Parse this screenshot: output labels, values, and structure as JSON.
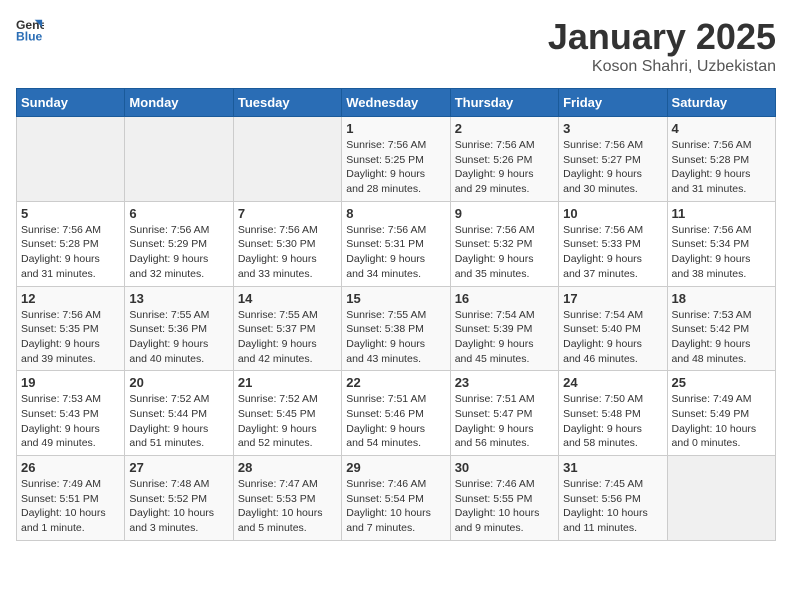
{
  "header": {
    "logo_general": "General",
    "logo_blue": "Blue",
    "title": "January 2025",
    "subtitle": "Koson Shahri, Uzbekistan"
  },
  "weekdays": [
    "Sunday",
    "Monday",
    "Tuesday",
    "Wednesday",
    "Thursday",
    "Friday",
    "Saturday"
  ],
  "weeks": [
    [
      {
        "day": "",
        "info": ""
      },
      {
        "day": "",
        "info": ""
      },
      {
        "day": "",
        "info": ""
      },
      {
        "day": "1",
        "info": "Sunrise: 7:56 AM\nSunset: 5:25 PM\nDaylight: 9 hours\nand 28 minutes."
      },
      {
        "day": "2",
        "info": "Sunrise: 7:56 AM\nSunset: 5:26 PM\nDaylight: 9 hours\nand 29 minutes."
      },
      {
        "day": "3",
        "info": "Sunrise: 7:56 AM\nSunset: 5:27 PM\nDaylight: 9 hours\nand 30 minutes."
      },
      {
        "day": "4",
        "info": "Sunrise: 7:56 AM\nSunset: 5:28 PM\nDaylight: 9 hours\nand 31 minutes."
      }
    ],
    [
      {
        "day": "5",
        "info": "Sunrise: 7:56 AM\nSunset: 5:28 PM\nDaylight: 9 hours\nand 31 minutes."
      },
      {
        "day": "6",
        "info": "Sunrise: 7:56 AM\nSunset: 5:29 PM\nDaylight: 9 hours\nand 32 minutes."
      },
      {
        "day": "7",
        "info": "Sunrise: 7:56 AM\nSunset: 5:30 PM\nDaylight: 9 hours\nand 33 minutes."
      },
      {
        "day": "8",
        "info": "Sunrise: 7:56 AM\nSunset: 5:31 PM\nDaylight: 9 hours\nand 34 minutes."
      },
      {
        "day": "9",
        "info": "Sunrise: 7:56 AM\nSunset: 5:32 PM\nDaylight: 9 hours\nand 35 minutes."
      },
      {
        "day": "10",
        "info": "Sunrise: 7:56 AM\nSunset: 5:33 PM\nDaylight: 9 hours\nand 37 minutes."
      },
      {
        "day": "11",
        "info": "Sunrise: 7:56 AM\nSunset: 5:34 PM\nDaylight: 9 hours\nand 38 minutes."
      }
    ],
    [
      {
        "day": "12",
        "info": "Sunrise: 7:56 AM\nSunset: 5:35 PM\nDaylight: 9 hours\nand 39 minutes."
      },
      {
        "day": "13",
        "info": "Sunrise: 7:55 AM\nSunset: 5:36 PM\nDaylight: 9 hours\nand 40 minutes."
      },
      {
        "day": "14",
        "info": "Sunrise: 7:55 AM\nSunset: 5:37 PM\nDaylight: 9 hours\nand 42 minutes."
      },
      {
        "day": "15",
        "info": "Sunrise: 7:55 AM\nSunset: 5:38 PM\nDaylight: 9 hours\nand 43 minutes."
      },
      {
        "day": "16",
        "info": "Sunrise: 7:54 AM\nSunset: 5:39 PM\nDaylight: 9 hours\nand 45 minutes."
      },
      {
        "day": "17",
        "info": "Sunrise: 7:54 AM\nSunset: 5:40 PM\nDaylight: 9 hours\nand 46 minutes."
      },
      {
        "day": "18",
        "info": "Sunrise: 7:53 AM\nSunset: 5:42 PM\nDaylight: 9 hours\nand 48 minutes."
      }
    ],
    [
      {
        "day": "19",
        "info": "Sunrise: 7:53 AM\nSunset: 5:43 PM\nDaylight: 9 hours\nand 49 minutes."
      },
      {
        "day": "20",
        "info": "Sunrise: 7:52 AM\nSunset: 5:44 PM\nDaylight: 9 hours\nand 51 minutes."
      },
      {
        "day": "21",
        "info": "Sunrise: 7:52 AM\nSunset: 5:45 PM\nDaylight: 9 hours\nand 52 minutes."
      },
      {
        "day": "22",
        "info": "Sunrise: 7:51 AM\nSunset: 5:46 PM\nDaylight: 9 hours\nand 54 minutes."
      },
      {
        "day": "23",
        "info": "Sunrise: 7:51 AM\nSunset: 5:47 PM\nDaylight: 9 hours\nand 56 minutes."
      },
      {
        "day": "24",
        "info": "Sunrise: 7:50 AM\nSunset: 5:48 PM\nDaylight: 9 hours\nand 58 minutes."
      },
      {
        "day": "25",
        "info": "Sunrise: 7:49 AM\nSunset: 5:49 PM\nDaylight: 10 hours\nand 0 minutes."
      }
    ],
    [
      {
        "day": "26",
        "info": "Sunrise: 7:49 AM\nSunset: 5:51 PM\nDaylight: 10 hours\nand 1 minute."
      },
      {
        "day": "27",
        "info": "Sunrise: 7:48 AM\nSunset: 5:52 PM\nDaylight: 10 hours\nand 3 minutes."
      },
      {
        "day": "28",
        "info": "Sunrise: 7:47 AM\nSunset: 5:53 PM\nDaylight: 10 hours\nand 5 minutes."
      },
      {
        "day": "29",
        "info": "Sunrise: 7:46 AM\nSunset: 5:54 PM\nDaylight: 10 hours\nand 7 minutes."
      },
      {
        "day": "30",
        "info": "Sunrise: 7:46 AM\nSunset: 5:55 PM\nDaylight: 10 hours\nand 9 minutes."
      },
      {
        "day": "31",
        "info": "Sunrise: 7:45 AM\nSunset: 5:56 PM\nDaylight: 10 hours\nand 11 minutes."
      },
      {
        "day": "",
        "info": ""
      }
    ]
  ]
}
